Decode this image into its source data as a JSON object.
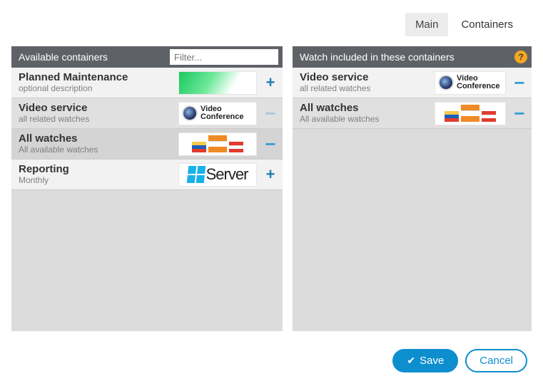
{
  "tabs": {
    "main": "Main",
    "containers": "Containers"
  },
  "left": {
    "title": "Available containers",
    "filter_placeholder": "Filter...",
    "items": [
      {
        "title": "Planned Maintenance",
        "sub": "optional description",
        "thumb": "green",
        "action": "add"
      },
      {
        "title": "Video service",
        "sub": "all related watches",
        "thumb": "vc",
        "action": "remove_faded"
      },
      {
        "title": "All watches",
        "sub": "All available watches",
        "thumb": "flags",
        "action": "remove"
      },
      {
        "title": "Reporting",
        "sub": "Monthly",
        "thumb": "server",
        "action": "add"
      }
    ]
  },
  "right": {
    "title": "Watch included in these containers",
    "items": [
      {
        "title": "Video service",
        "sub": "all related watches",
        "thumb": "vc",
        "action": "remove"
      },
      {
        "title": "All watches",
        "sub": "All available watches",
        "thumb": "flags",
        "action": "remove"
      }
    ]
  },
  "thumbs": {
    "vc_line1": "Video",
    "vc_line2": "Conference",
    "server_text": "Server"
  },
  "footer": {
    "save": "Save",
    "cancel": "Cancel"
  }
}
